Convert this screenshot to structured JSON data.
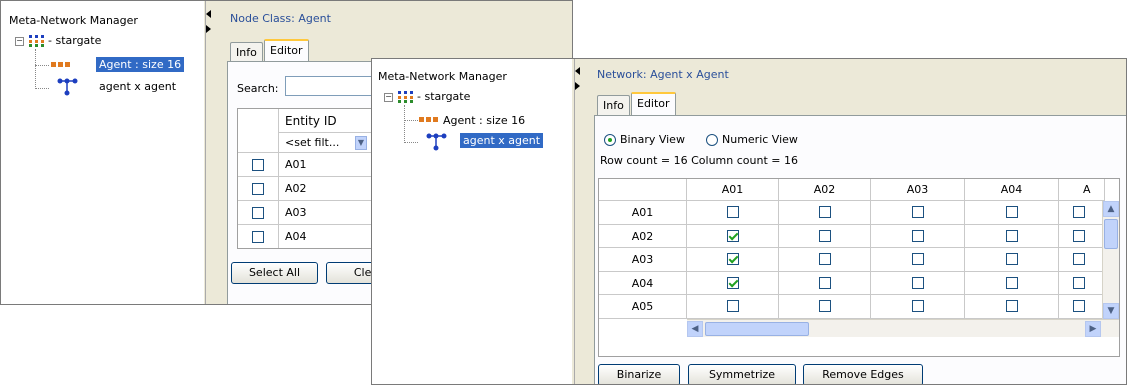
{
  "back_window": {
    "tree": {
      "title": "Meta-Network Manager",
      "root_label": "- stargate",
      "items": [
        {
          "label": "Agent : size 16",
          "icon": "node-class-icon",
          "selected": true
        },
        {
          "label": "agent x agent",
          "icon": "network-icon",
          "selected": false
        }
      ]
    },
    "section_title": "Node Class: Agent",
    "tabs": [
      {
        "label": "Info",
        "active": false
      },
      {
        "label": "Editor",
        "active": true
      }
    ],
    "search": {
      "label": "Search:",
      "value": ""
    },
    "table": {
      "header": "Entity ID",
      "filter_placeholder": "<set filt...",
      "rows": [
        {
          "id": "A01",
          "checked": false
        },
        {
          "id": "A02",
          "checked": false
        },
        {
          "id": "A03",
          "checked": false
        },
        {
          "id": "A04",
          "checked": false
        }
      ]
    },
    "buttons": {
      "select_all": "Select All",
      "clear": "Clea"
    }
  },
  "front_window": {
    "tree": {
      "title": "Meta-Network Manager",
      "root_label": "- stargate",
      "items": [
        {
          "label": "Agent : size 16",
          "icon": "node-class-icon",
          "selected": false
        },
        {
          "label": "agent x agent",
          "icon": "network-icon",
          "selected": true
        }
      ]
    },
    "section_title": "Network: Agent x Agent",
    "tabs": [
      {
        "label": "Info",
        "active": false
      },
      {
        "label": "Editor",
        "active": true
      }
    ],
    "view_options": [
      {
        "label": "Binary View",
        "selected": true
      },
      {
        "label": "Numeric View",
        "selected": false
      }
    ],
    "counts_text": "Row count = 16 Column count = 16",
    "matrix": {
      "columns": [
        "A01",
        "A02",
        "A03",
        "A04",
        "A"
      ],
      "rows": [
        {
          "label": "A01",
          "values": [
            false,
            false,
            false,
            false
          ]
        },
        {
          "label": "A02",
          "values": [
            true,
            false,
            false,
            false
          ]
        },
        {
          "label": "A03",
          "values": [
            true,
            false,
            false,
            false
          ]
        },
        {
          "label": "A04",
          "values": [
            true,
            false,
            false,
            false
          ]
        },
        {
          "label": "A05",
          "values": [
            false,
            false,
            false,
            false
          ]
        }
      ]
    },
    "buttons": {
      "binarize": "Binarize",
      "symmetrize": "Symmetrize",
      "remove_edges": "Remove Edges"
    }
  },
  "colors": {
    "selection": "#316ac5",
    "section_title": "#2a4f9a",
    "tab_highlight": "#ffc83c",
    "check": "#21a121"
  }
}
